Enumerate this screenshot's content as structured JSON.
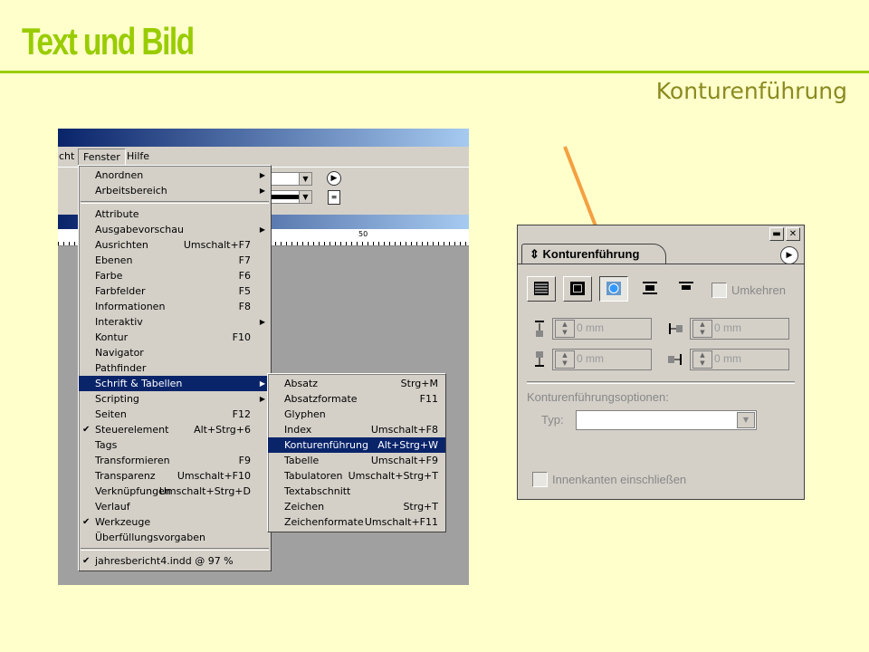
{
  "slide": {
    "title": "Text und Bild",
    "subtitle": "Konturenführung",
    "accent": "#99cc00",
    "arrow_color": "#f4a040"
  },
  "app": {
    "menubar": [
      "cht",
      "Fenster",
      "Hilfe"
    ],
    "ruler_label": "50"
  },
  "fenster_menu": {
    "items": [
      {
        "label": "Anordnen",
        "shortcut": "",
        "submenu": true,
        "checked": false
      },
      {
        "label": "Arbeitsbereich",
        "shortcut": "",
        "submenu": true,
        "checked": false
      },
      {
        "separator": true
      },
      {
        "label": "Attribute",
        "shortcut": "",
        "submenu": false,
        "checked": false
      },
      {
        "label": "Ausgabevorschau",
        "shortcut": "",
        "submenu": true,
        "checked": false
      },
      {
        "label": "Ausrichten",
        "shortcut": "Umschalt+F7",
        "submenu": false,
        "checked": false
      },
      {
        "label": "Ebenen",
        "shortcut": "F7",
        "submenu": false,
        "checked": false
      },
      {
        "label": "Farbe",
        "shortcut": "F6",
        "submenu": false,
        "checked": false
      },
      {
        "label": "Farbfelder",
        "shortcut": "F5",
        "submenu": false,
        "checked": false
      },
      {
        "label": "Informationen",
        "shortcut": "F8",
        "submenu": false,
        "checked": false
      },
      {
        "label": "Interaktiv",
        "shortcut": "",
        "submenu": true,
        "checked": false
      },
      {
        "label": "Kontur",
        "shortcut": "F10",
        "submenu": false,
        "checked": false
      },
      {
        "label": "Navigator",
        "shortcut": "",
        "submenu": false,
        "checked": false
      },
      {
        "label": "Pathfinder",
        "shortcut": "",
        "submenu": false,
        "checked": false
      },
      {
        "label": "Schrift & Tabellen",
        "shortcut": "",
        "submenu": true,
        "checked": false,
        "highlighted": true
      },
      {
        "label": "Scripting",
        "shortcut": "",
        "submenu": true,
        "checked": false
      },
      {
        "label": "Seiten",
        "shortcut": "F12",
        "submenu": false,
        "checked": false
      },
      {
        "label": "Steuerelement",
        "shortcut": "Alt+Strg+6",
        "submenu": false,
        "checked": true
      },
      {
        "label": "Tags",
        "shortcut": "",
        "submenu": false,
        "checked": false
      },
      {
        "label": "Transformieren",
        "shortcut": "F9",
        "submenu": false,
        "checked": false
      },
      {
        "label": "Transparenz",
        "shortcut": "Umschalt+F10",
        "submenu": false,
        "checked": false
      },
      {
        "label": "Verknüpfungen",
        "shortcut": "Umschalt+Strg+D",
        "submenu": false,
        "checked": false
      },
      {
        "label": "Verlauf",
        "shortcut": "",
        "submenu": false,
        "checked": false
      },
      {
        "label": "Werkzeuge",
        "shortcut": "",
        "submenu": false,
        "checked": true
      },
      {
        "label": "Überfüllungsvorgaben",
        "shortcut": "",
        "submenu": false,
        "checked": false
      },
      {
        "separator": true
      },
      {
        "label": "jahresbericht4.indd @ 97 %",
        "shortcut": "",
        "submenu": false,
        "checked": true
      }
    ]
  },
  "schrift_submenu": {
    "items": [
      {
        "label": "Absatz",
        "shortcut": "Strg+M"
      },
      {
        "label": "Absatzformate",
        "shortcut": "F11"
      },
      {
        "label": "Glyphen",
        "shortcut": ""
      },
      {
        "label": "Index",
        "shortcut": "Umschalt+F8"
      },
      {
        "label": "Konturenführung",
        "shortcut": "Alt+Strg+W",
        "highlighted": true
      },
      {
        "label": "Tabelle",
        "shortcut": "Umschalt+F9"
      },
      {
        "label": "Tabulatoren",
        "shortcut": "Umschalt+Strg+T"
      },
      {
        "label": "Textabschnitt",
        "shortcut": ""
      },
      {
        "label": "Zeichen",
        "shortcut": "Strg+T"
      },
      {
        "label": "Zeichenformate",
        "shortcut": "Umschalt+F11"
      }
    ]
  },
  "panel": {
    "tab_title": "Konturenführung",
    "invert_label": "Umkehren",
    "offsets": [
      "0 mm",
      "0 mm",
      "0 mm",
      "0 mm"
    ],
    "options_label": "Konturenführungsoptionen:",
    "type_label": "Typ:",
    "type_value": "",
    "inner_edges_label": "Innenkanten einschließen"
  }
}
